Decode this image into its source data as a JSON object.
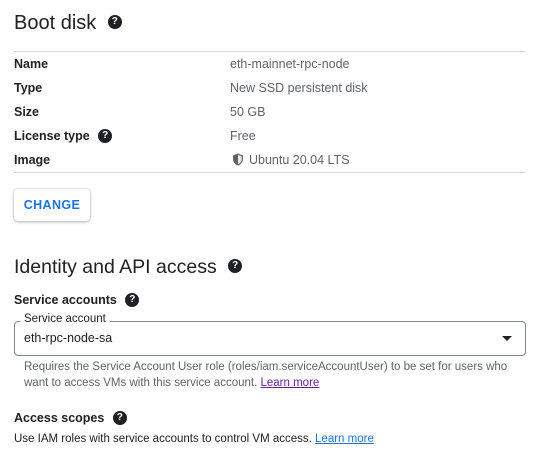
{
  "boot_disk": {
    "title": "Boot disk",
    "rows": [
      {
        "label": "Name",
        "value": "eth-mainnet-rpc-node"
      },
      {
        "label": "Type",
        "value": "New SSD persistent disk"
      },
      {
        "label": "Size",
        "value": "50 GB"
      },
      {
        "label": "License type",
        "value": "Free"
      },
      {
        "label": "Image",
        "value": "Ubuntu 20.04 LTS"
      }
    ],
    "change_label": "CHANGE"
  },
  "identity": {
    "title": "Identity and API access",
    "service_accounts_label": "Service accounts",
    "service_account_field_label": "Service account",
    "service_account_value": "eth-rpc-node-sa",
    "service_account_hint": "Requires the Service Account User role (roles/iam.serviceAccountUser) to be set for users who want to access VMs with this service account.",
    "service_account_learn_more": "Learn more",
    "access_scopes_label": "Access scopes",
    "access_scopes_text": "Use IAM roles with service accounts to control VM access.",
    "access_scopes_learn_more": "Learn more"
  },
  "icons": {
    "help": "help-icon",
    "shield": "shield-icon",
    "dropdown": "caret-down-icon"
  }
}
